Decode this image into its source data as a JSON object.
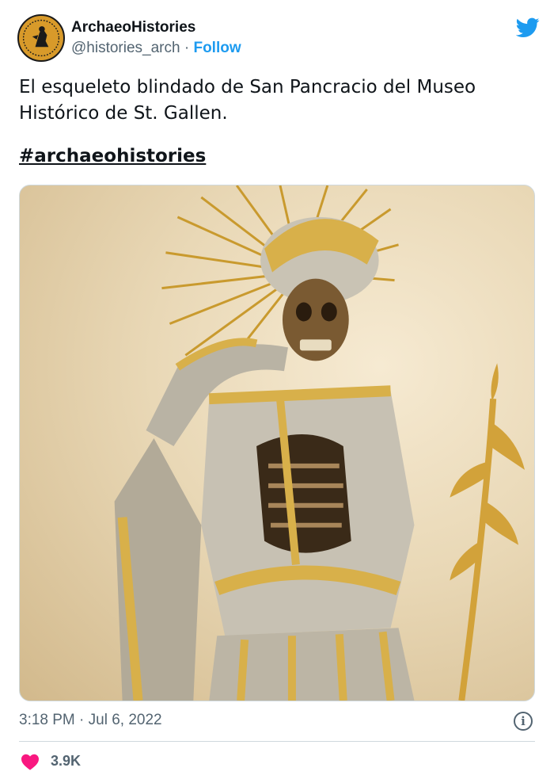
{
  "account": {
    "display_name": "ArchaeoHistories",
    "handle": "@histories_arch",
    "separator": " · ",
    "follow_label": "Follow"
  },
  "tweet": {
    "text": "El esqueleto blindado de San Pancracio del Museo Histórico de St. Gallen.",
    "hashtag": "#archaeohistories",
    "timestamp": "3:18 PM · Jul 6, 2022",
    "info_icon_glyph": "i",
    "likes": "3.9K"
  },
  "icons": {
    "brand": "twitter-bird-icon",
    "info": "info-icon",
    "like": "heart-icon"
  },
  "colors": {
    "accent": "#1d9bf0",
    "heart": "#f91880",
    "secondary_text": "#536471"
  }
}
